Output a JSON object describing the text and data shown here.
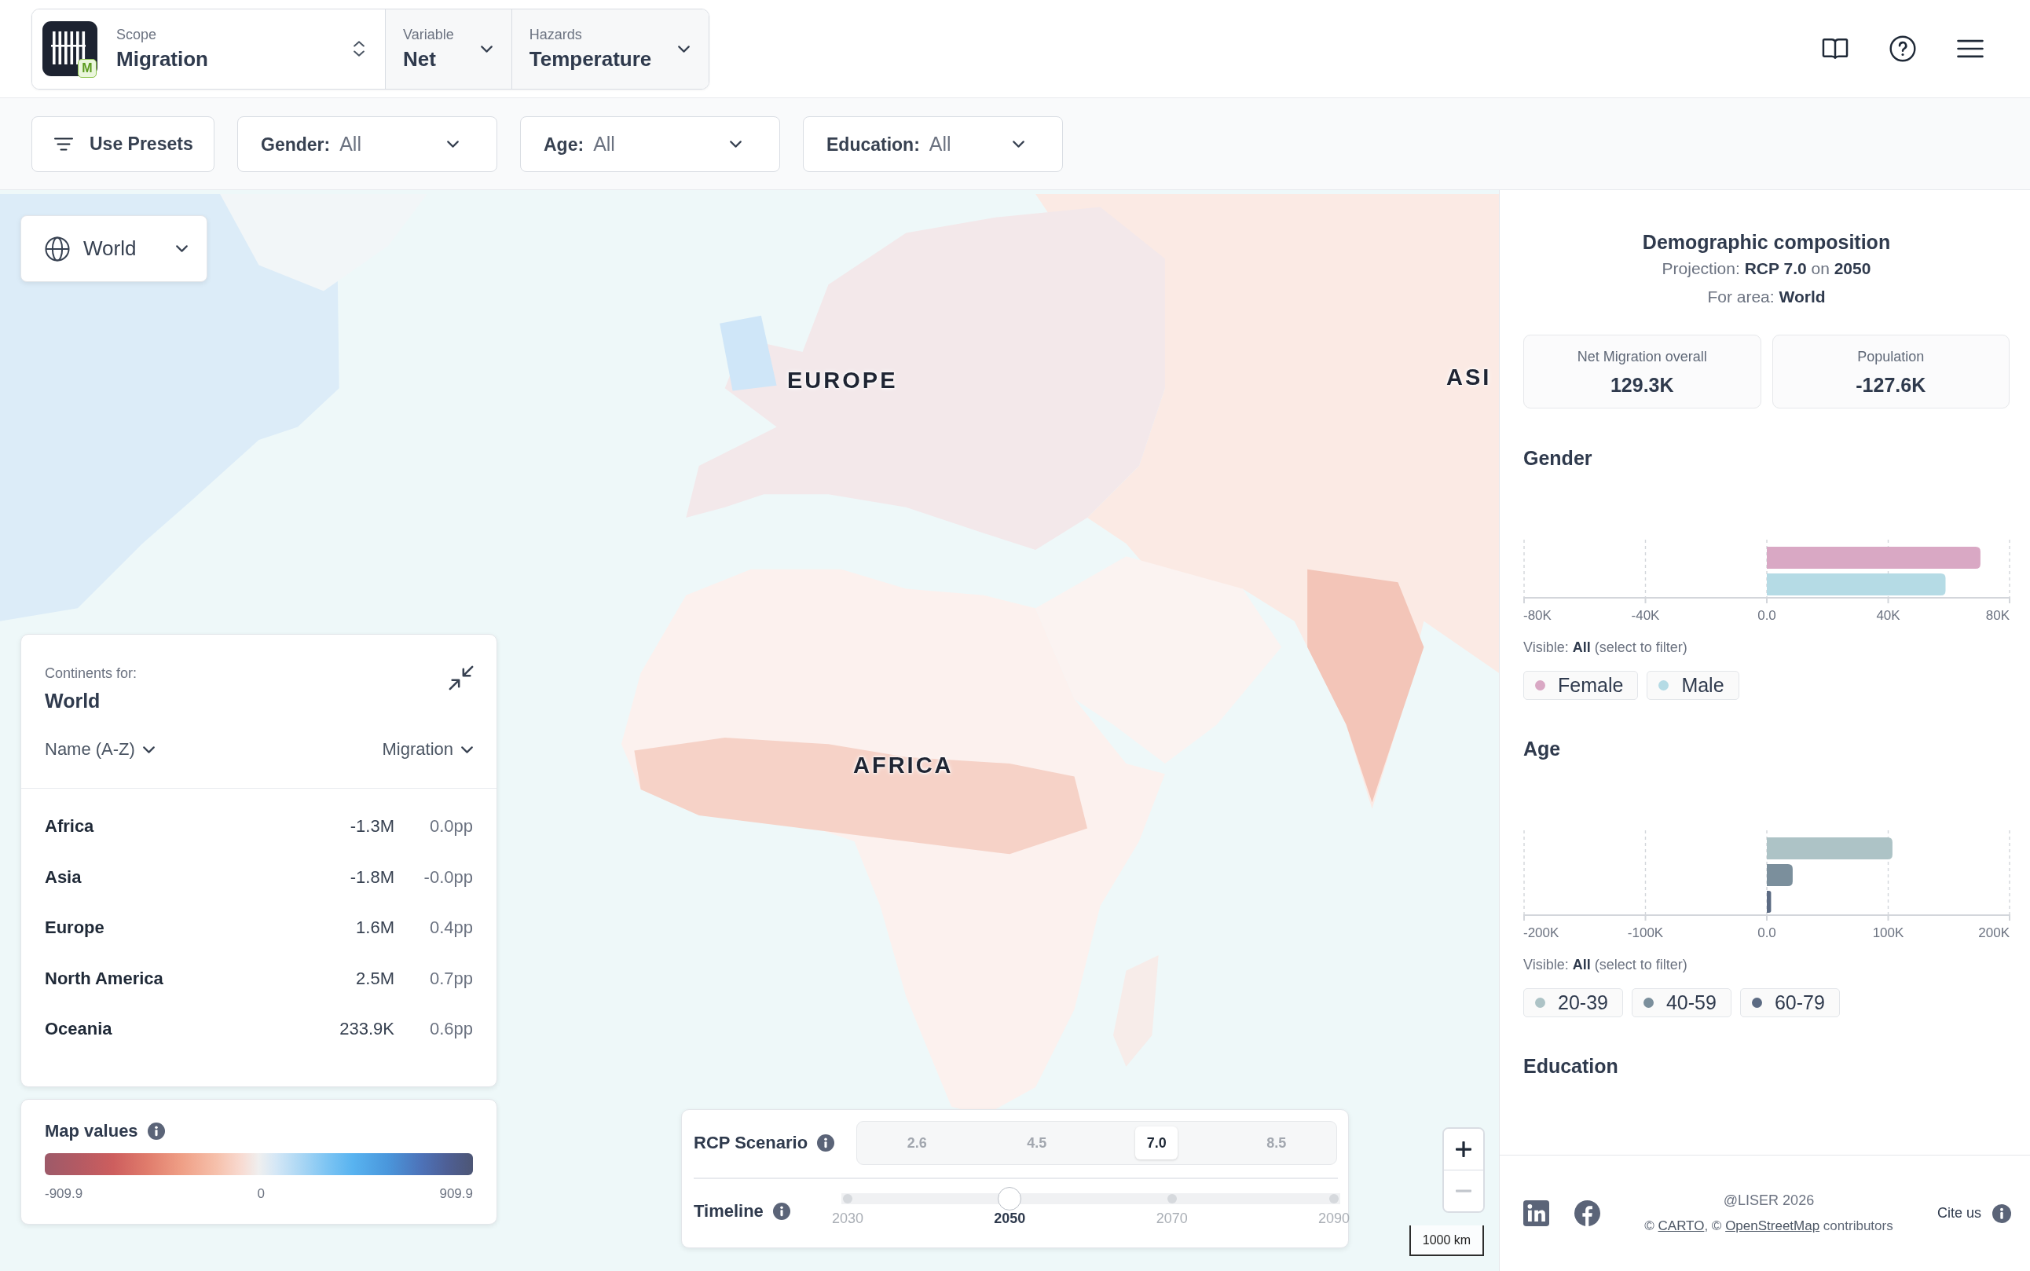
{
  "header": {
    "logo_badge": "M",
    "selectors": [
      {
        "kind": "updown",
        "label": "Scope",
        "value": "Migration"
      },
      {
        "kind": "dropdown",
        "label": "Variable",
        "value": "Net"
      },
      {
        "kind": "dropdown",
        "label": "Hazards",
        "value": "Temperature"
      }
    ]
  },
  "filters": {
    "presets": "Use Presets",
    "dropdowns": [
      {
        "label": "Gender:",
        "value": "All"
      },
      {
        "label": "Age:",
        "value": "All"
      },
      {
        "label": "Education:",
        "value": "All"
      }
    ]
  },
  "map": {
    "area_selector": "World",
    "labels": [
      "EUROPE",
      "AFRICA",
      "ASI"
    ]
  },
  "continents_panel": {
    "caption": "Continents for:",
    "area": "World",
    "sort_name": "Name (A-Z)",
    "sort_metric": "Migration",
    "rows": [
      {
        "name": "Africa",
        "value": "-1.3M",
        "change": "0.0pp"
      },
      {
        "name": "Asia",
        "value": "-1.8M",
        "change": "-0.0pp"
      },
      {
        "name": "Europe",
        "value": "1.6M",
        "change": "0.4pp"
      },
      {
        "name": "North America",
        "value": "2.5M",
        "change": "0.7pp"
      },
      {
        "name": "Oceania",
        "value": "233.9K",
        "change": "0.6pp"
      }
    ]
  },
  "map_values": {
    "title": "Map values",
    "scale_labels": [
      "-909.9",
      "0",
      "909.9"
    ]
  },
  "rcp_panel": {
    "scenario_label": "RCP Scenario",
    "scenarios": [
      {
        "label": "2.6",
        "selected": false
      },
      {
        "label": "4.5",
        "selected": false
      },
      {
        "label": "7.0",
        "selected": true
      },
      {
        "label": "8.5",
        "selected": false
      }
    ],
    "timeline_label": "Timeline",
    "years": [
      {
        "label": "2030",
        "selected": false
      },
      {
        "label": "2050",
        "selected": true
      },
      {
        "label": "2070",
        "selected": false
      },
      {
        "label": "2090",
        "selected": false
      }
    ]
  },
  "zoom_controls": [
    {
      "kind": "zoom_in",
      "disabled": false
    },
    {
      "kind": "zoom_out",
      "disabled": true
    }
  ],
  "scale_bar": "1000 km",
  "side_panel": {
    "title": "Demographic composition",
    "projection": "Projection: **RCP 7.0** on **2050**",
    "area": "For area: **World**",
    "stats": [
      {
        "label": "Net Migration overall",
        "value": "129.3K"
      },
      {
        "label": "Population",
        "value": "-127.6K"
      }
    ],
    "sections": [
      {
        "title": "Gender",
        "chart_data": {
          "type": "bar",
          "orientation": "horizontal",
          "categories": [
            null
          ],
          "series": [
            {
              "name": "Female",
              "color": "#d9a8c4",
              "values": [
                70.4
              ]
            },
            {
              "name": "Male",
              "color": "#b5dbe5",
              "values": [
                58.9
              ]
            }
          ],
          "xlim": [
            -80,
            80
          ],
          "xticks": [
            {
              "value": -80,
              "label": "-80K"
            },
            {
              "value": -40,
              "label": "-40K"
            },
            {
              "value": 0,
              "label": "0.0"
            },
            {
              "value": 40,
              "label": "40K"
            },
            {
              "value": 80,
              "label": "80K"
            }
          ],
          "grid": true
        },
        "visible_note": "Visible: **All** (select to filter)"
      },
      {
        "title": "Age",
        "chart_data": {
          "type": "bar",
          "orientation": "horizontal",
          "categories": [
            null
          ],
          "series": [
            {
              "name": "20-39",
              "color": "#adc3c6",
              "values": [
                103.5
              ]
            },
            {
              "name": "40-59",
              "color": "#7b8f9c",
              "values": [
                21.3
              ]
            },
            {
              "name": "60-79",
              "color": "#5c6b83",
              "values": [
                3.5
              ]
            }
          ],
          "xlim": [
            -200,
            200
          ],
          "xticks": [
            {
              "value": -200,
              "label": "-200K"
            },
            {
              "value": -100,
              "label": "-100K"
            },
            {
              "value": 0,
              "label": "0.0"
            },
            {
              "value": 100,
              "label": "100K"
            },
            {
              "value": 200,
              "label": "200K"
            }
          ],
          "grid": true
        },
        "visible_note": "Visible: **All** (select to filter)"
      },
      {
        "title": "Education"
      }
    ],
    "footer": {
      "copyright": "@LISER 2026",
      "attribution": [
        {
          "kind": "text",
          "text": "© "
        },
        {
          "kind": "link",
          "text": "CARTO"
        },
        {
          "kind": "text",
          "text": ", © "
        },
        {
          "kind": "link",
          "text": "OpenStreetMap"
        },
        {
          "kind": "text",
          "text": " contributors"
        }
      ],
      "cite": "Cite us"
    }
  }
}
